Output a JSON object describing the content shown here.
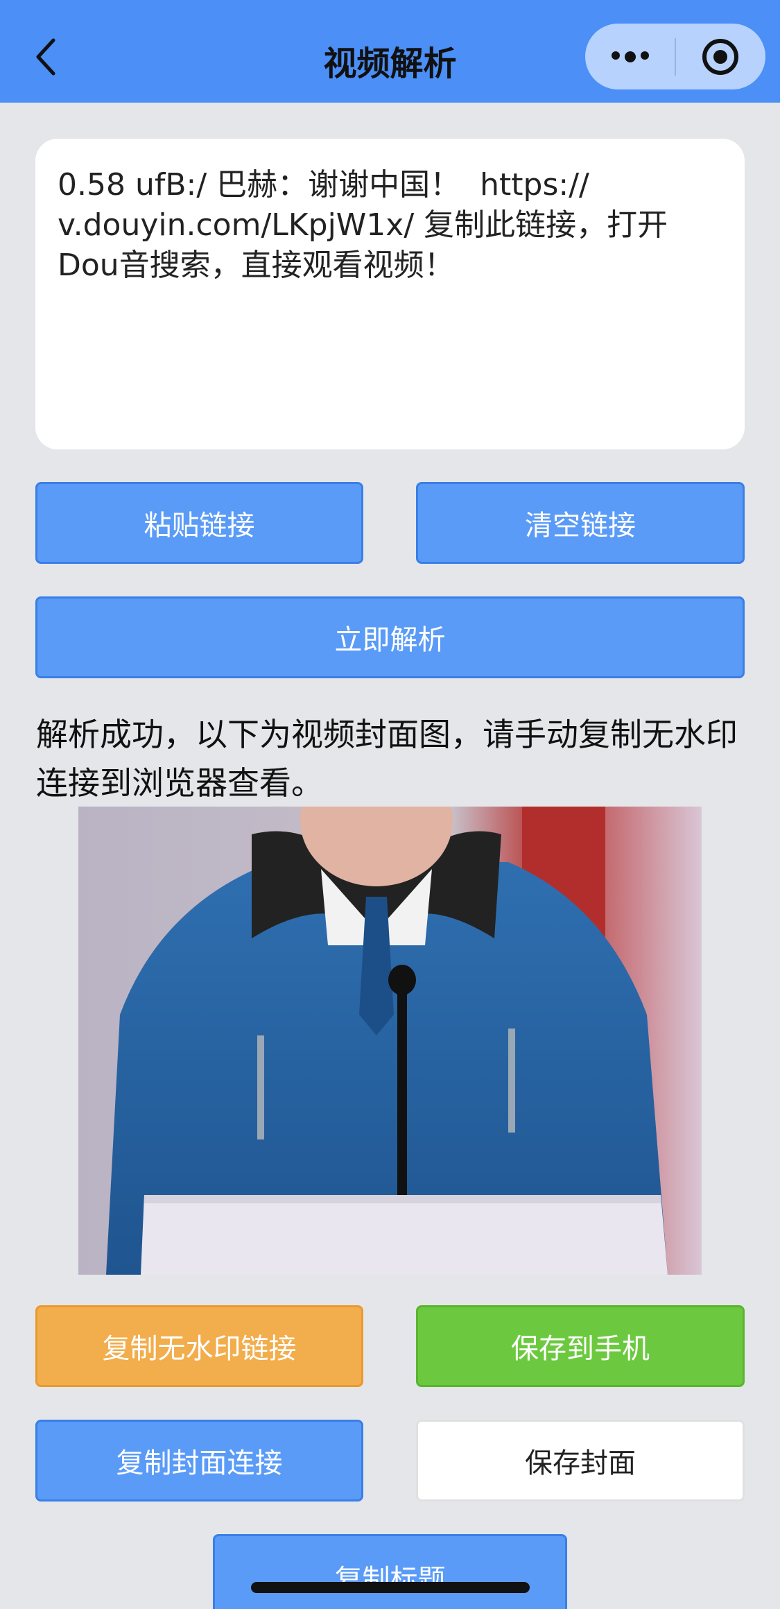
{
  "nav": {
    "title": "视频解析",
    "back_icon": "chevron-left-icon",
    "more_icon": "more-dots-icon",
    "close_icon": "target-circle-icon"
  },
  "input": {
    "value": "0.58 ufB:/ 巴赫：谢谢中国！  https://\nv.douyin.com/LKpjW1x/ 复制此链接，打开\nDou音搜索，直接观看视频！"
  },
  "buttons": {
    "paste": "粘贴链接",
    "clear": "清空链接",
    "parse": "立即解析",
    "copy_no_watermark": "复制无水印链接",
    "save_to_phone": "保存到手机",
    "copy_cover_link": "复制封面连接",
    "save_cover": "保存封面",
    "copy_title": "复制标题"
  },
  "result": {
    "message": "解析成功，以下为视频封面图，请手动复制无水印连接到浏览器查看。"
  },
  "colors": {
    "navbar": "#4b8ff7",
    "primary_button": "#5a9bf7",
    "orange_button": "#f2ad4c",
    "green_button": "#6cc93f",
    "background": "#e5e6ea"
  }
}
